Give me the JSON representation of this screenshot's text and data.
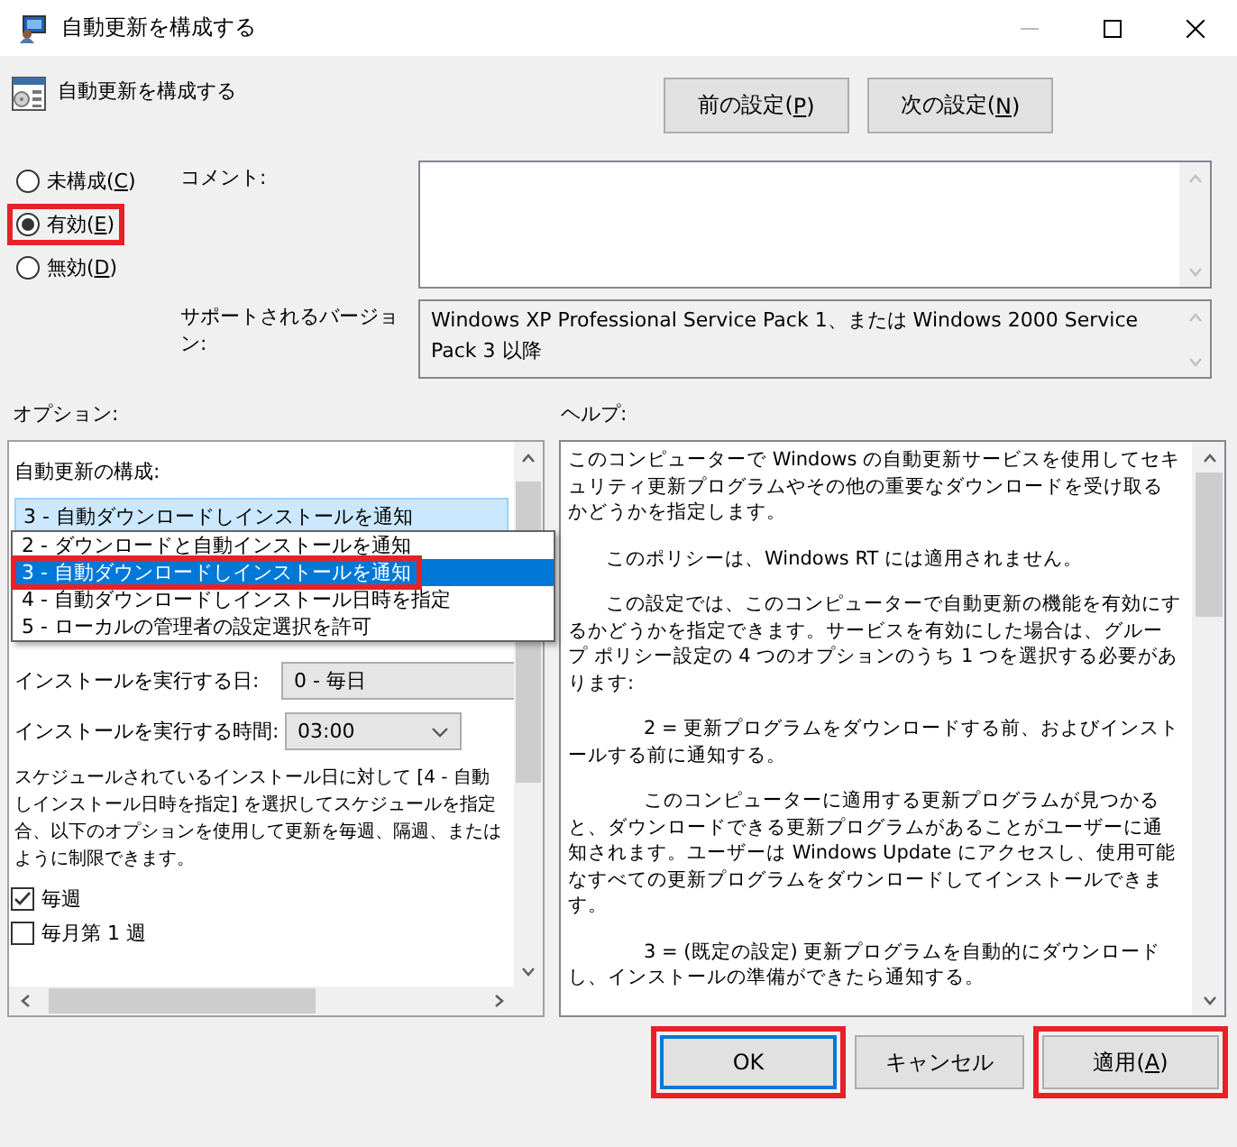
{
  "window": {
    "title": "自動更新を構成する"
  },
  "header": {
    "title": "自動更新を構成する",
    "buttons": [
      {
        "label": "前の設定(P)",
        "underline_key": true
      },
      {
        "label": "次の設定(N)",
        "underline_key": true
      }
    ]
  },
  "state_options": [
    {
      "label": "未構成(C)",
      "selected": false,
      "highlighted": false,
      "underline_key": true
    },
    {
      "label": "有効(E)",
      "selected": true,
      "highlighted": true,
      "underline_key": true
    },
    {
      "label": "無効(D)",
      "selected": false,
      "highlighted": false,
      "underline_key": true
    }
  ],
  "comment": {
    "label": "コメント:"
  },
  "supported": {
    "label": "サポートされるバージョン:",
    "value": "Windows XP Professional Service Pack 1、または Windows 2000 Service Pack 3 以降"
  },
  "options": {
    "label": "オプション:",
    "setting_label": "自動更新の構成:",
    "combo_value": "3 - 自動ダウンロードしインストールを通知",
    "dropdown": [
      {
        "label": "2 - ダウンロードと自動インストールを通知",
        "selected": false,
        "highlighted": false
      },
      {
        "label": "3 - 自動ダウンロードしインストールを通知",
        "selected": true,
        "highlighted": true
      },
      {
        "label": "4 - 自動ダウンロードしインストール日時を指定",
        "selected": false,
        "highlighted": false
      },
      {
        "label": "5 - ローカルの管理者の設定選択を許可",
        "selected": false,
        "highlighted": false
      }
    ],
    "day": {
      "label": "インストールを実行する日:",
      "value": "0 - 毎日"
    },
    "time": {
      "label": "インストールを実行する時間:",
      "value": "03:00"
    },
    "note_lines": [
      "スケジュールされているインストール日に対して [4 - 自動",
      "しインストール日時を指定] を選択してスケジュールを指定",
      "合、以下のオプションを使用して更新を毎週、隔週、または",
      "ように制限できます。"
    ],
    "checkboxes": [
      {
        "label": "毎週",
        "checked": true
      },
      {
        "label": "毎月第 1 週",
        "checked": false
      }
    ]
  },
  "help": {
    "label": "ヘルプ:",
    "paragraphs": [
      {
        "kind": "plain",
        "text": "このコンピューターで Windows の自動更新サービスを使用してセキュリティ更新プログラムやその他の重要なダウンロードを受け取るかどうかを指定します。"
      },
      {
        "kind": "indented",
        "text": "このポリシーは、Windows RT には適用されません。"
      },
      {
        "kind": "indented",
        "text": "この設定では、このコンピューターで自動更新の機能を有効にするかどうかを指定できます。サービスを有効にした場合は、グループ ポリシー設定の 4 つのオプションのうち 1 つを選択する必要があります:"
      },
      {
        "kind": "option",
        "text": "2 = 更新プログラムをダウンロードする前、およびインストールする前に通知する。"
      },
      {
        "kind": "option",
        "text": "このコンピューターに適用する更新プログラムが見つかると、ダウンロードできる更新プログラムがあることがユーザーに通知されます。ユーザーは Windows Update にアクセスし、使用可能なすべての更新プログラムをダウンロードしてインストールできます。"
      },
      {
        "kind": "option",
        "text": "3 = (既定の設定) 更新プログラムを自動的にダウンロードし、インストールの準備ができたら通知する。"
      }
    ]
  },
  "buttons": [
    {
      "label": "OK",
      "default": true,
      "highlighted": true,
      "underline_key": false
    },
    {
      "label": "キャンセル",
      "default": false,
      "highlighted": false,
      "underline_key": false
    },
    {
      "label": "適用(A)",
      "default": false,
      "highlighted": true,
      "underline_key": true
    }
  ]
}
